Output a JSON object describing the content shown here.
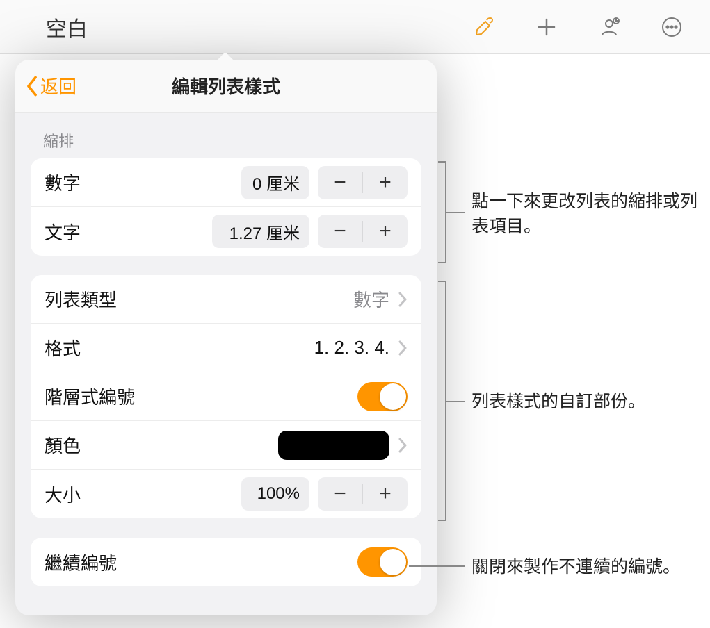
{
  "toolbar": {
    "title": "空白"
  },
  "popover": {
    "back_label": "返回",
    "title": "編輯列表樣式",
    "indent_section_label": "縮排",
    "rows": {
      "number_indent": {
        "label": "數字",
        "value": "0 厘米"
      },
      "text_indent": {
        "label": "文字",
        "value": "1.27 厘米"
      },
      "list_type": {
        "label": "列表類型",
        "value": "數字"
      },
      "format": {
        "label": "格式",
        "value": "1. 2. 3. 4."
      },
      "tiered": {
        "label": "階層式編號",
        "on": true
      },
      "color": {
        "label": "顏色",
        "value_hex": "#000000"
      },
      "size": {
        "label": "大小",
        "value": "100%"
      },
      "continue": {
        "label": "繼續編號",
        "on": true
      }
    }
  },
  "callouts": {
    "indent": "點一下來更改列表的縮排或列表項目。",
    "custom": "列表樣式的自訂部份。",
    "continue": "關閉來製作不連續的編號。"
  }
}
